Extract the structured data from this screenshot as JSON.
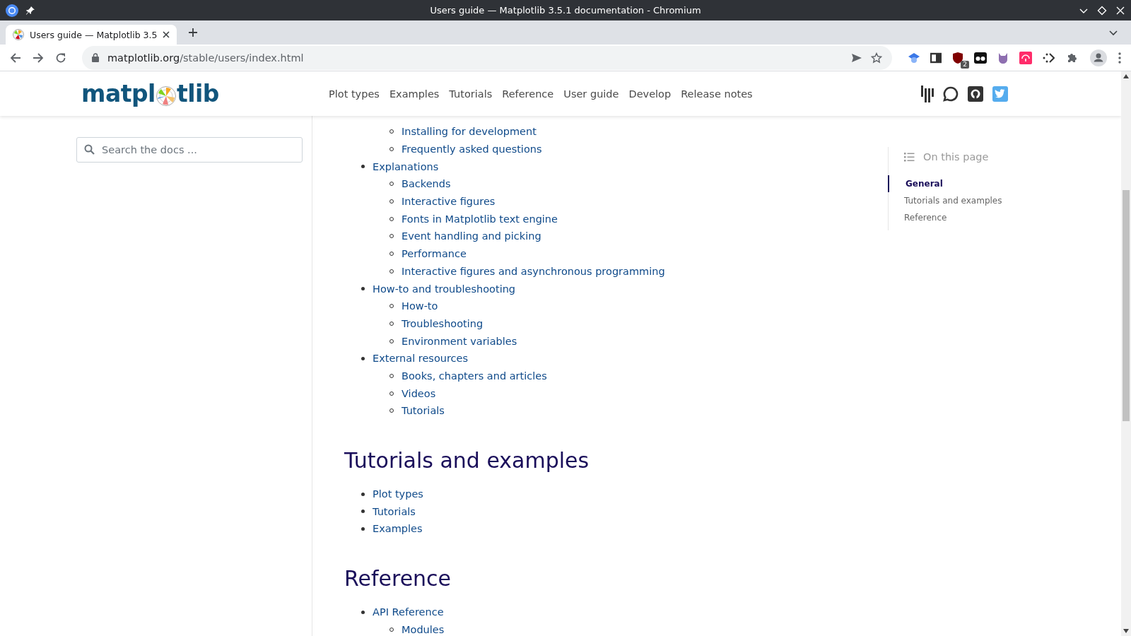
{
  "window": {
    "title": "Users guide — Matplotlib 3.5.1 documentation - Chromium"
  },
  "tabs": [
    {
      "title": "Users guide — Matplotlib 3.5",
      "selected": true
    }
  ],
  "address_bar": {
    "host": "matplotlib.org",
    "path": "/stable/users/index.html"
  },
  "extension_badge": "2",
  "site_header": {
    "logo_parts": [
      "matpl",
      "tlib"
    ],
    "nav": [
      "Plot types",
      "Examples",
      "Tutorials",
      "Reference",
      "User guide",
      "Develop",
      "Release notes"
    ]
  },
  "search": {
    "placeholder": "Search the docs ..."
  },
  "sections": [
    {
      "items": [
        {
          "children": [
            {
              "label": "Installing for development"
            },
            {
              "label": "Frequently asked questions"
            }
          ]
        },
        {
          "label": "Explanations",
          "children": [
            {
              "label": "Backends"
            },
            {
              "label": "Interactive figures"
            },
            {
              "label": "Fonts in Matplotlib text engine"
            },
            {
              "label": "Event handling and picking"
            },
            {
              "label": "Performance"
            },
            {
              "label": "Interactive figures and asynchronous programming"
            }
          ]
        },
        {
          "label": "How-to and troubleshooting",
          "children": [
            {
              "label": "How-to"
            },
            {
              "label": "Troubleshooting"
            },
            {
              "label": "Environment variables"
            }
          ]
        },
        {
          "label": "External resources",
          "children": [
            {
              "label": "Books, chapters and articles"
            },
            {
              "label": "Videos"
            },
            {
              "label": "Tutorials"
            }
          ]
        }
      ]
    },
    {
      "heading": "Tutorials and examples",
      "items": [
        {
          "label": "Plot types"
        },
        {
          "label": "Tutorials"
        },
        {
          "label": "Examples"
        }
      ]
    },
    {
      "heading": "Reference",
      "items": [
        {
          "label": "API Reference",
          "children": [
            {
              "label": "Modules"
            }
          ]
        }
      ]
    }
  ],
  "toc": {
    "title": "On this page",
    "items": [
      {
        "label": "General",
        "selected": true
      },
      {
        "label": "Tutorials and examples",
        "selected": false
      },
      {
        "label": "Reference",
        "selected": false
      }
    ]
  }
}
